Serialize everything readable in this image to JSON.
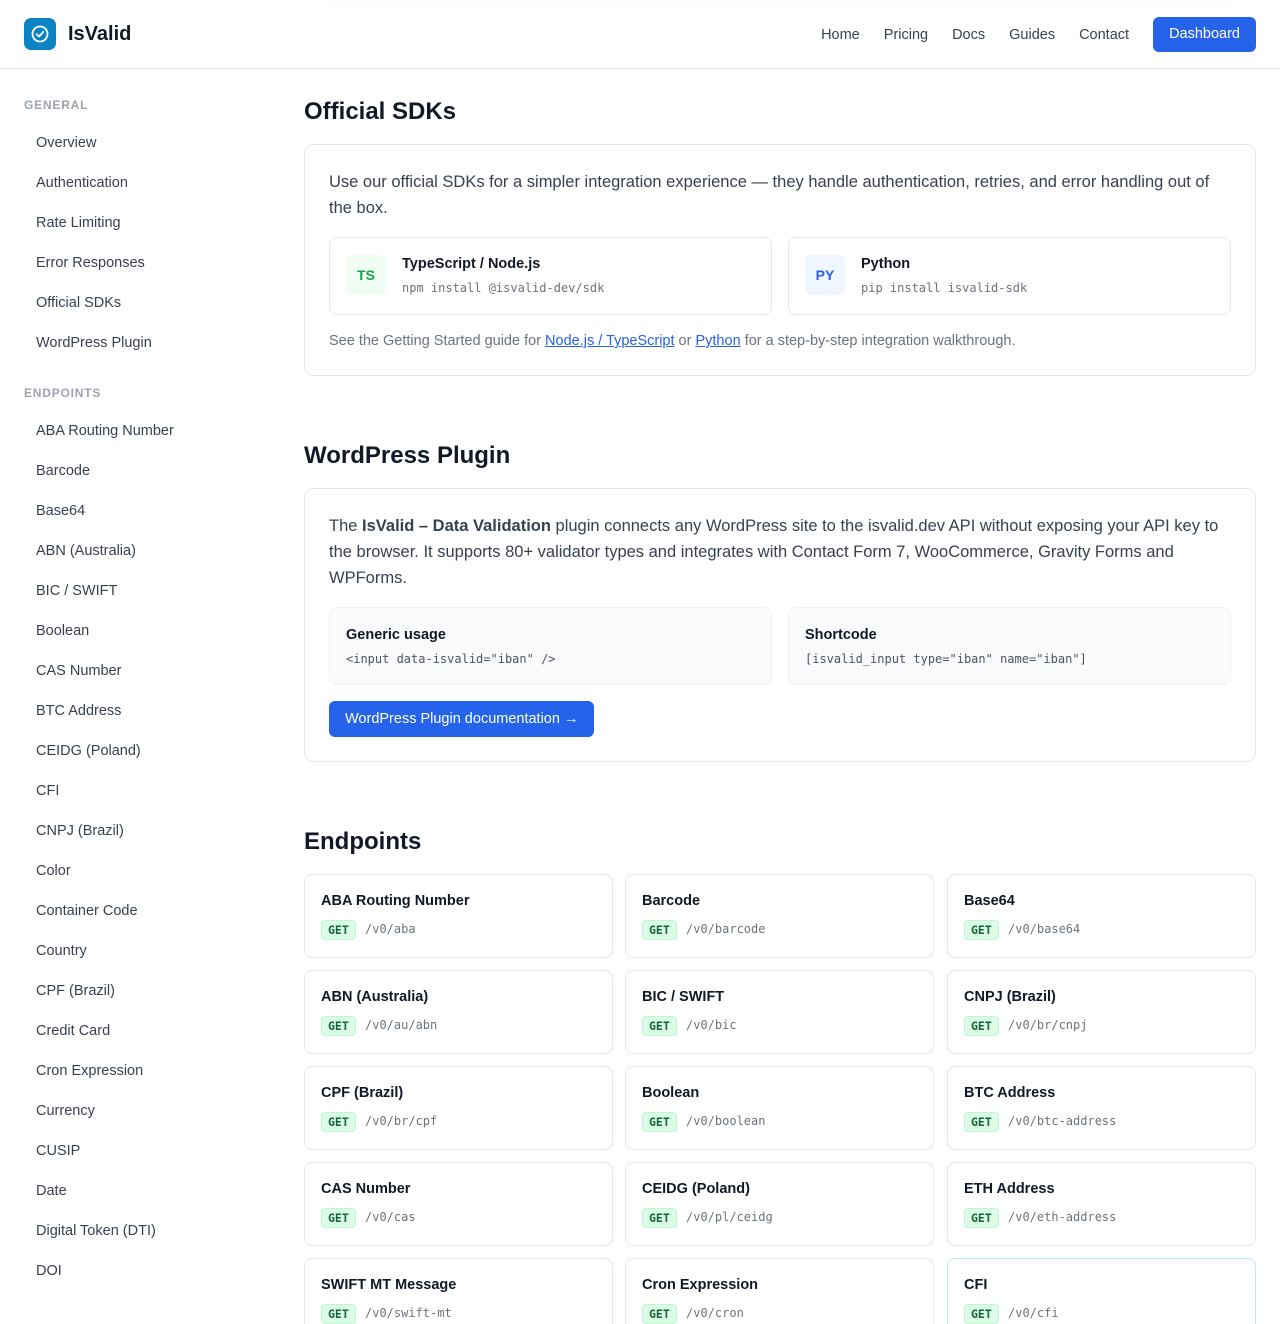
{
  "header": {
    "brand": "IsValid",
    "nav": [
      "Home",
      "Pricing",
      "Docs",
      "Guides",
      "Contact"
    ],
    "dashboard": "Dashboard"
  },
  "sidebar": {
    "general_label": "GENERAL",
    "general": [
      "Overview",
      "Authentication",
      "Rate Limiting",
      "Error Responses",
      "Official SDKs",
      "WordPress Plugin"
    ],
    "endpoints_label": "ENDPOINTS",
    "endpoints": [
      "ABA Routing Number",
      "Barcode",
      "Base64",
      "ABN (Australia)",
      "BIC / SWIFT",
      "Boolean",
      "CAS Number",
      "BTC Address",
      "CEIDG (Poland)",
      "CFI",
      "CNPJ (Brazil)",
      "Color",
      "Container Code",
      "Country",
      "CPF (Brazil)",
      "Credit Card",
      "Cron Expression",
      "Currency",
      "CUSIP",
      "Date",
      "Digital Token (DTI)",
      "DOI"
    ]
  },
  "sdks": {
    "title": "Official SDKs",
    "intro": "Use our official SDKs for a simpler integration experience — they handle authentication, retries, and error handling out of the box.",
    "ts": {
      "badge": "TS",
      "name": "TypeScript / Node.js",
      "cmd": "npm install @isvalid-dev/sdk"
    },
    "py": {
      "badge": "PY",
      "name": "Python",
      "cmd": "pip install isvalid-sdk"
    },
    "guide_pre": "See the Getting Started guide for ",
    "guide_link1": "Node.js / TypeScript",
    "guide_or": " or ",
    "guide_link2": "Python",
    "guide_post": " for a step-by-step integration walkthrough."
  },
  "wordpress": {
    "title": "WordPress Plugin",
    "intro_pre": "The ",
    "plugin_name": "IsValid – Data Validation",
    "intro_post": " plugin connects any WordPress site to the isvalid.dev API without exposing your API key to the browser. It supports 80+ validator types and integrates with Contact Form 7, WooCommerce, Gravity Forms and WPForms.",
    "generic": {
      "title": "Generic usage",
      "code": "<input data-isvalid=\"iban\" />"
    },
    "shortcode": {
      "title": "Shortcode",
      "code": "[isvalid_input type=\"iban\" name=\"iban\"]"
    },
    "button": "WordPress Plugin documentation →"
  },
  "endpoints": {
    "title": "Endpoints",
    "method": "GET",
    "items": [
      {
        "name": "ABA Routing Number",
        "path": "/v0/aba"
      },
      {
        "name": "Barcode",
        "path": "/v0/barcode"
      },
      {
        "name": "Base64",
        "path": "/v0/base64"
      },
      {
        "name": "ABN (Australia)",
        "path": "/v0/au/abn"
      },
      {
        "name": "BIC / SWIFT",
        "path": "/v0/bic"
      },
      {
        "name": "CNPJ (Brazil)",
        "path": "/v0/br/cnpj"
      },
      {
        "name": "CPF (Brazil)",
        "path": "/v0/br/cpf"
      },
      {
        "name": "Boolean",
        "path": "/v0/boolean"
      },
      {
        "name": "BTC Address",
        "path": "/v0/btc-address"
      },
      {
        "name": "CAS Number",
        "path": "/v0/cas"
      },
      {
        "name": "CEIDG (Poland)",
        "path": "/v0/pl/ceidg"
      },
      {
        "name": "ETH Address",
        "path": "/v0/eth-address"
      },
      {
        "name": "SWIFT MT Message",
        "path": "/v0/swift-mt"
      },
      {
        "name": "Cron Expression",
        "path": "/v0/cron"
      },
      {
        "name": "CFI",
        "path": "/v0/cfi"
      }
    ]
  }
}
